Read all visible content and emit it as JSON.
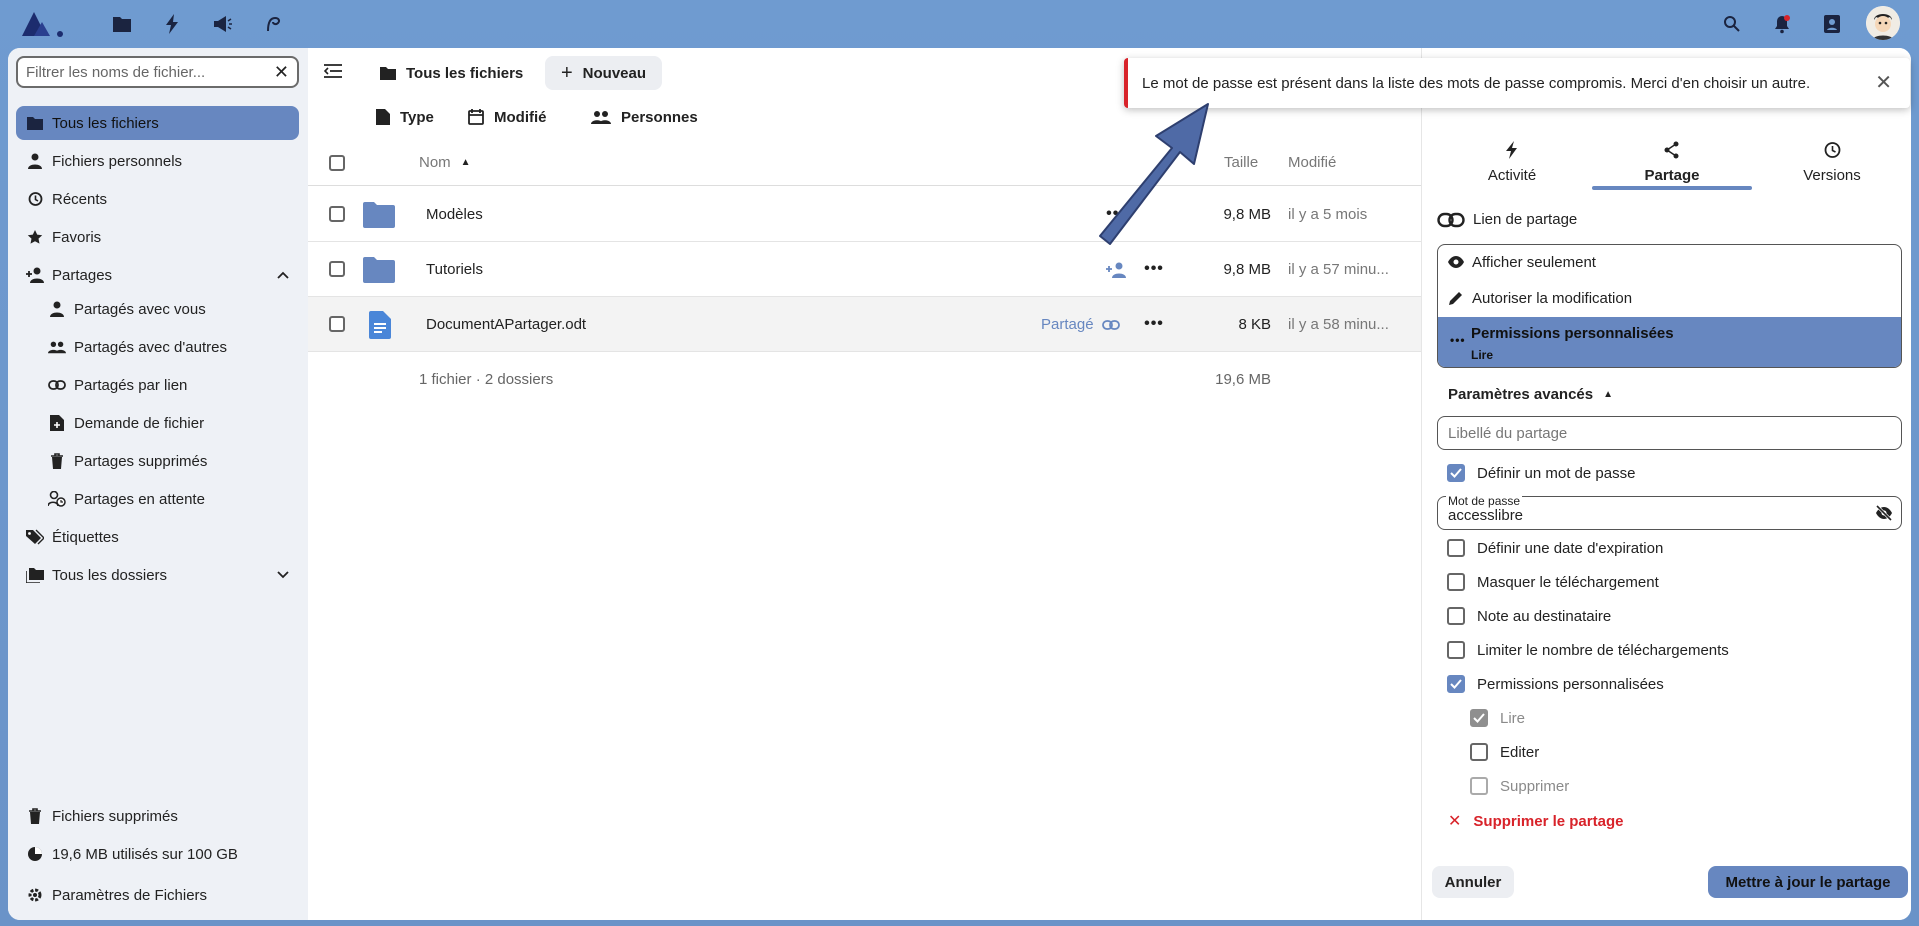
{
  "topbar": {
    "icons": [
      "logo",
      "files-icon",
      "activity-icon",
      "announcements-icon",
      "talk-icon",
      "search-icon",
      "notifications-icon",
      "contacts-icon",
      "avatar"
    ]
  },
  "nav": {
    "filter_placeholder": "Filtrer les noms de fichier...",
    "items": [
      {
        "label": "Tous les fichiers"
      },
      {
        "label": "Fichiers personnels"
      },
      {
        "label": "Récents"
      },
      {
        "label": "Favoris"
      },
      {
        "label": "Partages"
      },
      {
        "label": "Partagés avec vous"
      },
      {
        "label": "Partagés avec d'autres"
      },
      {
        "label": "Partagés par lien"
      },
      {
        "label": "Demande de fichier"
      },
      {
        "label": "Partages supprimés"
      },
      {
        "label": "Partages en attente"
      },
      {
        "label": "Étiquettes"
      },
      {
        "label": "Tous les dossiers"
      }
    ],
    "trash": "Fichiers supprimés",
    "quota": "19,6 MB utilisés sur 100 GB",
    "settings": "Paramètres de Fichiers"
  },
  "main": {
    "breadcrumb": "Tous les fichiers",
    "new_button": "Nouveau",
    "filters": [
      "Type",
      "Modifié",
      "Personnes"
    ],
    "columns": {
      "name": "Nom",
      "size": "Taille",
      "modified": "Modifié"
    },
    "rows": [
      {
        "name": "Modèles",
        "size": "9,8 MB",
        "modified": "il y a 5 mois",
        "type": "folder"
      },
      {
        "name": "Tutoriels",
        "size": "9,8 MB",
        "modified": "il y a 57 minu...",
        "type": "folder"
      },
      {
        "name": "DocumentAPartager.odt",
        "size": "8 KB",
        "modified": "il y a 58 minu...",
        "type": "document",
        "shared_label": "Partagé"
      }
    ],
    "summary": "1 fichier · 2 dossiers",
    "summary_size": "19,6 MB"
  },
  "toast": {
    "message": "Le mot de passe est présent dans la liste des mots de passe compromis. Merci d'en choisir un autre.",
    "accent": "#d8232a"
  },
  "sidebar": {
    "tabs": [
      "Activité",
      "Partage",
      "Versions"
    ],
    "share_link_title": "Lien de partage",
    "permission_options": [
      "Afficher seulement",
      "Autoriser la modification"
    ],
    "permission_selected": "Permissions personnalisées",
    "permission_selected_sub": "Lire",
    "advanced": "Paramètres avancés",
    "label_placeholder": "Libellé du partage",
    "set_password": "Définir un mot de passe",
    "password_label": "Mot de passe",
    "password_value": "accesslibre",
    "options": [
      {
        "label": "Définir une date d'expiration",
        "checked": false
      },
      {
        "label": "Masquer le téléchargement",
        "checked": false
      },
      {
        "label": "Note au destinataire",
        "checked": false
      },
      {
        "label": "Limiter le nombre de téléchargements",
        "checked": false
      },
      {
        "label": "Permissions personnalisées",
        "checked": true
      }
    ],
    "custom_perms": [
      {
        "label": "Lire",
        "checked": true
      },
      {
        "label": "Editer",
        "checked": false
      },
      {
        "label": "Supprimer",
        "checked": false
      }
    ],
    "delete_share": "Supprimer le partage",
    "cancel": "Annuler",
    "update": "Mettre à jour le partage"
  },
  "colors": {
    "accent": "#6787c0",
    "danger": "#d8232a",
    "background": "#6f9bd0"
  }
}
